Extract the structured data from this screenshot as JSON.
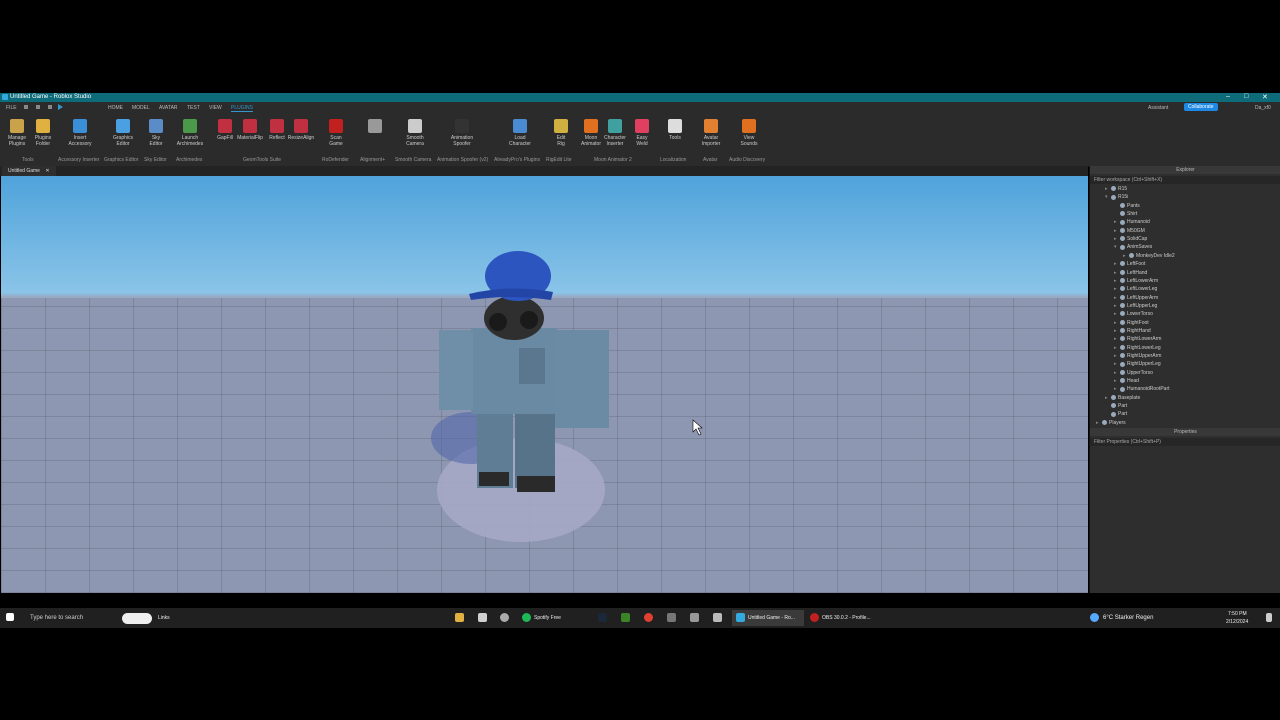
{
  "titlebar": {
    "title": "Untitled Game - Roblox Studio",
    "minimize": "–",
    "maximize": "□",
    "close": "✕"
  },
  "menu": {
    "file": "FILE",
    "tabs": [
      "HOME",
      "MODEL",
      "AVATAR",
      "TEST",
      "VIEW",
      "PLUGINS"
    ],
    "active_tab": "PLUGINS",
    "assistant": "Assistant",
    "collaborate": "Collaborate",
    "user": "Da_xf0"
  },
  "ribbon": {
    "buttons": [
      {
        "label": "Manage\nPlugins",
        "icon": "manage-plugins-icon",
        "color": "#c9a24a"
      },
      {
        "label": "Plugins\nFolder",
        "icon": "folder-icon",
        "color": "#e0b040"
      },
      {
        "label": "Insert\nAccessory",
        "icon": "accessory-icon",
        "color": "#3a8fd6"
      },
      {
        "label": "Graphics\nEditor",
        "icon": "fx-icon",
        "color": "#4aa0e0"
      },
      {
        "label": "Sky\nEditor",
        "icon": "sky-icon",
        "color": "#5a8cc8"
      },
      {
        "label": "Launch\nArchimedes",
        "icon": "archimedes-icon",
        "color": "#4a9a4a"
      },
      {
        "label": "GapFill",
        "icon": "gapfill-icon",
        "color": "#c03040"
      },
      {
        "label": "MaterialFlip",
        "icon": "materialflip-icon",
        "color": "#c03040"
      },
      {
        "label": "Reflect",
        "icon": "reflect-icon",
        "color": "#c03040"
      },
      {
        "label": "ResizeAlign",
        "icon": "resizealign-icon",
        "color": "#c03040"
      },
      {
        "label": "Scan\nGame",
        "icon": "scan-icon",
        "color": "#c02020"
      },
      {
        "label": "",
        "icon": "alignment-icon",
        "color": "#999999"
      },
      {
        "label": "Smooth\nCamera",
        "icon": "camera-icon",
        "color": "#cccccc"
      },
      {
        "label": "Animation\nSpoofer",
        "icon": "animation-spoofer-icon",
        "color": "#333333"
      },
      {
        "label": "Load\nCharacter",
        "icon": "load-character-icon",
        "color": "#4a8ad0"
      },
      {
        "label": "Edit\nRig",
        "icon": "edit-rig-icon",
        "color": "#d0b040"
      },
      {
        "label": "Moon\nAnimator",
        "icon": "moon-animator-icon",
        "color": "#e07020"
      },
      {
        "label": "Character\nInserter",
        "icon": "character-inserter-icon",
        "color": "#40a0a0"
      },
      {
        "label": "Easy\nWeld",
        "icon": "easy-weld-icon",
        "color": "#e04060"
      },
      {
        "label": "Tools",
        "icon": "tools-icon",
        "color": "#dddddd"
      },
      {
        "label": "Avatar\nImporter",
        "icon": "avatar-importer-icon",
        "color": "#e08030"
      },
      {
        "label": "View\nSounds",
        "icon": "sounds-icon",
        "color": "#e07020"
      }
    ],
    "groups": [
      "Tools",
      "Accessory Inserter",
      "Graphics Editor",
      "Sky Editor",
      "Archimedes",
      "GeomTools Suite",
      "RoDefender",
      "Alignment+",
      "Smooth Camera",
      "Animation Spoofer (v2)",
      "AlreadyPro's Plugins",
      "RigEdit Lite",
      "Moon Animator 2",
      "Localization",
      "Avatar",
      "Audio Discovery"
    ]
  },
  "document": {
    "tab": "Untitled Game",
    "close": "✕"
  },
  "explorer": {
    "title": "Explorer",
    "filter": "Filter workspace (Ctrl+Shift+X)",
    "items": [
      {
        "label": "R15",
        "depth": 1,
        "arrow": "▸"
      },
      {
        "label": "R15i",
        "depth": 1,
        "arrow": "▾"
      },
      {
        "label": "Pants",
        "depth": 2,
        "arrow": ""
      },
      {
        "label": "Shirt",
        "depth": 2,
        "arrow": ""
      },
      {
        "label": "Humanoid",
        "depth": 2,
        "arrow": "▸"
      },
      {
        "label": "M50GM",
        "depth": 2,
        "arrow": "▸"
      },
      {
        "label": "SolidCap",
        "depth": 2,
        "arrow": "▸"
      },
      {
        "label": "AnimSaves",
        "depth": 2,
        "arrow": "▾"
      },
      {
        "label": "MonkeyDev Idle2",
        "depth": 3,
        "arrow": "▸"
      },
      {
        "label": "LeftFoot",
        "depth": 2,
        "arrow": "▸"
      },
      {
        "label": "LeftHand",
        "depth": 2,
        "arrow": "▸"
      },
      {
        "label": "LeftLowerArm",
        "depth": 2,
        "arrow": "▸"
      },
      {
        "label": "LeftLowerLeg",
        "depth": 2,
        "arrow": "▸"
      },
      {
        "label": "LeftUpperArm",
        "depth": 2,
        "arrow": "▸"
      },
      {
        "label": "LeftUpperLeg",
        "depth": 2,
        "arrow": "▸"
      },
      {
        "label": "LowerTorso",
        "depth": 2,
        "arrow": "▸"
      },
      {
        "label": "RightFoot",
        "depth": 2,
        "arrow": "▸"
      },
      {
        "label": "RightHand",
        "depth": 2,
        "arrow": "▸"
      },
      {
        "label": "RightLowerArm",
        "depth": 2,
        "arrow": "▸"
      },
      {
        "label": "RightLowerLeg",
        "depth": 2,
        "arrow": "▸"
      },
      {
        "label": "RightUpperArm",
        "depth": 2,
        "arrow": "▸"
      },
      {
        "label": "RightUpperLeg",
        "depth": 2,
        "arrow": "▸"
      },
      {
        "label": "UpperTorso",
        "depth": 2,
        "arrow": "▸"
      },
      {
        "label": "Head",
        "depth": 2,
        "arrow": "▸"
      },
      {
        "label": "HumanoidRootPart",
        "depth": 2,
        "arrow": "▸"
      },
      {
        "label": "Baseplate",
        "depth": 1,
        "arrow": "▸"
      },
      {
        "label": "Part",
        "depth": 1,
        "arrow": ""
      },
      {
        "label": "Part",
        "depth": 1,
        "arrow": ""
      },
      {
        "label": "Players",
        "depth": 0,
        "arrow": "▸"
      }
    ]
  },
  "properties": {
    "title": "Properties",
    "filter": "Filter Properties (Ctrl+Shift+P)"
  },
  "taskbar": {
    "search_placeholder": "Type here to search",
    "links": "Links",
    "apps": [
      "Spotify Free",
      "Untitled Game - Ro...",
      "OBS 30.0.2 - Profile..."
    ],
    "weather": "6°C  Starker Regen",
    "time": "7:50 PM",
    "date": "2/12/2024"
  }
}
